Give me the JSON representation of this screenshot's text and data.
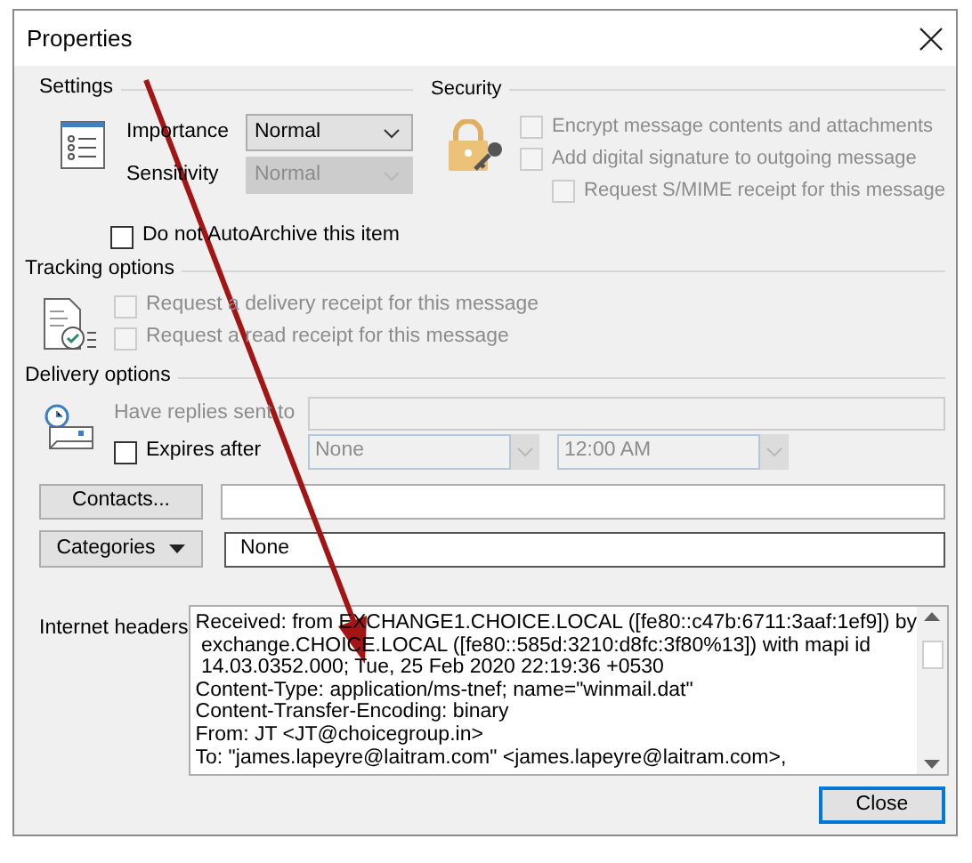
{
  "window": {
    "title": "Properties"
  },
  "settings": {
    "heading": "Settings",
    "fields": [
      {
        "label": "Importance",
        "value": "Normal",
        "disabled": false
      },
      {
        "label": "Sensitivity",
        "value": "Normal",
        "disabled": true
      }
    ],
    "auto_archive": {
      "label": "Do not AutoArchive this item",
      "checked": false,
      "disabled": false
    }
  },
  "security": {
    "heading": "Security",
    "options": [
      {
        "label": "Encrypt message contents and attachments",
        "checked": false,
        "disabled": true
      },
      {
        "label": "Add digital signature to outgoing message",
        "checked": false,
        "disabled": true,
        "children": [
          {
            "label": "Request S/MIME receipt for this message",
            "checked": false,
            "disabled": true
          }
        ]
      }
    ]
  },
  "tracking": {
    "heading": "Tracking options",
    "options": [
      {
        "label": "Request a delivery receipt for this message",
        "checked": false,
        "disabled": true
      },
      {
        "label": "Request a read receipt for this message",
        "checked": false,
        "disabled": true
      }
    ]
  },
  "delivery": {
    "heading": "Delivery options",
    "replies_label": "Have replies sent to",
    "replies_disabled": true,
    "expires": {
      "label": "Expires after",
      "checked": false,
      "date": "None",
      "time": "12:00 AM",
      "disabled": true
    }
  },
  "contacts_button": "Contacts...",
  "categories": {
    "button": "Categories",
    "value": "None"
  },
  "internet_headers": {
    "label": "Internet headers",
    "lines": [
      "Received: from EXCHANGE1.CHOICE.LOCAL ([fe80::c47b:6711:3aaf:1ef9]) by",
      " exchange.CHOICE.LOCAL ([fe80::585d:3210:d8fc:3f80%13]) with mapi id",
      " 14.03.0352.000; Tue, 25 Feb 2020 22:19:36 +0530",
      "Content-Type: application/ms-tnef; name=\"winmail.dat\"",
      "Content-Transfer-Encoding: binary",
      "From: JT <JT@choicegroup.in>",
      "To: \"james.lapeyre@laitram.com\" <james.lapeyre@laitram.com>,"
    ]
  },
  "close_button": "Close"
}
